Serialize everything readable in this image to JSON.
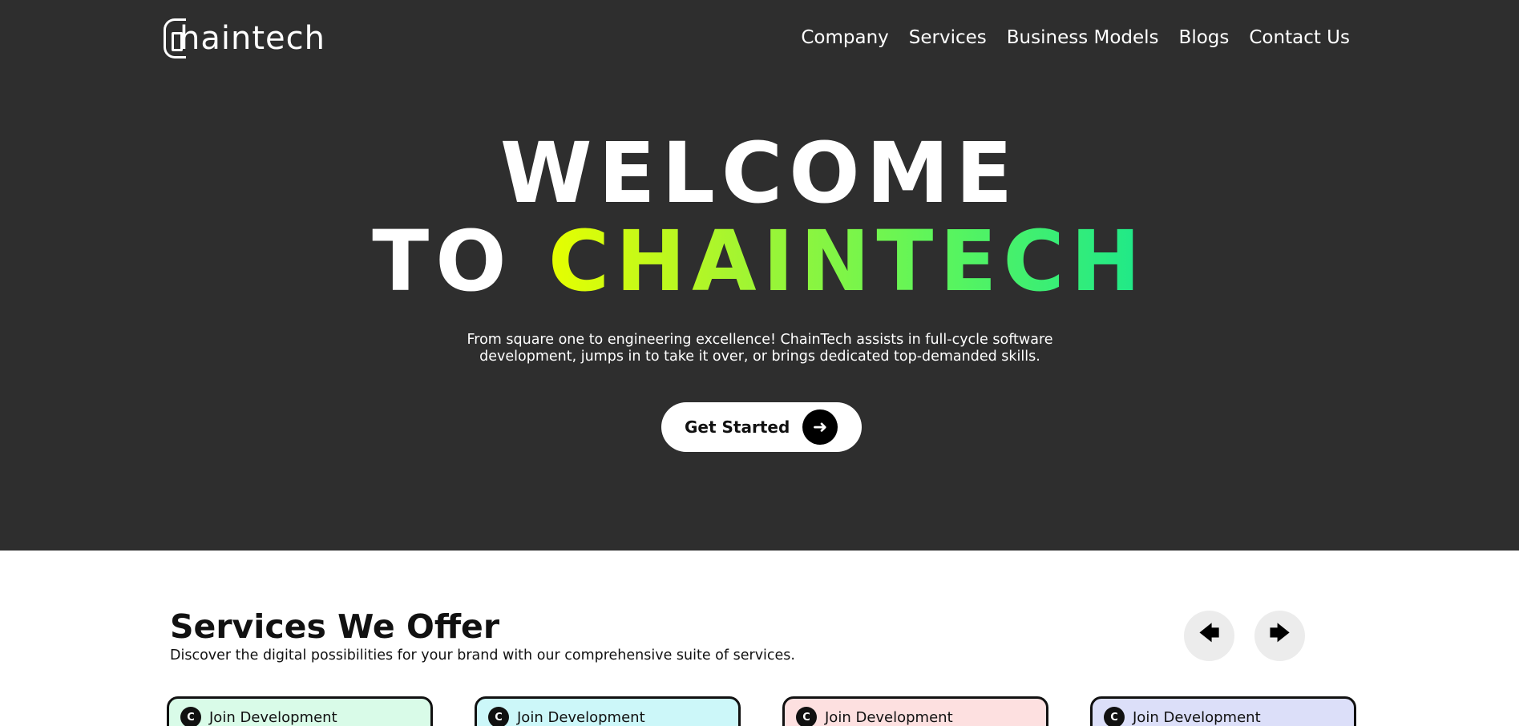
{
  "brand": {
    "logo_text": "haintech",
    "logo_mark": "C"
  },
  "nav": {
    "items": [
      {
        "label": "Company"
      },
      {
        "label": "Services"
      },
      {
        "label": "Business Models"
      },
      {
        "label": "Blogs"
      },
      {
        "label": "Contact Us"
      }
    ]
  },
  "hero": {
    "title_line1": "WELCOME",
    "title_line2_prefix": "TO ",
    "title_line2_brand": "CHAINTECH",
    "subtitle": "From square one to engineering excellence! ChainTech assists in full-cycle software development, jumps in to take it over, or brings dedicated top-demanded skills.",
    "cta_label": "Get Started",
    "cta_icon": "arrow-right-icon"
  },
  "services": {
    "title": "Services We Offer",
    "subtitle": "Discover the digital possibilities for your brand with our comprehensive suite of services.",
    "prev_icon": "arrow-left-icon",
    "next_icon": "arrow-right-icon",
    "cards": [
      {
        "label": "Join Development",
        "bg": "#d9fbe8"
      },
      {
        "label": "Join Development",
        "bg": "#ccf7f9"
      },
      {
        "label": "Join Development",
        "bg": "#fde0e0"
      },
      {
        "label": "Join Development",
        "bg": "#dcdff9"
      }
    ]
  },
  "colors": {
    "hero_bg": "#2e2e2e",
    "brand_gradient_start": "#e6ff00",
    "brand_gradient_end": "#1de88a"
  }
}
